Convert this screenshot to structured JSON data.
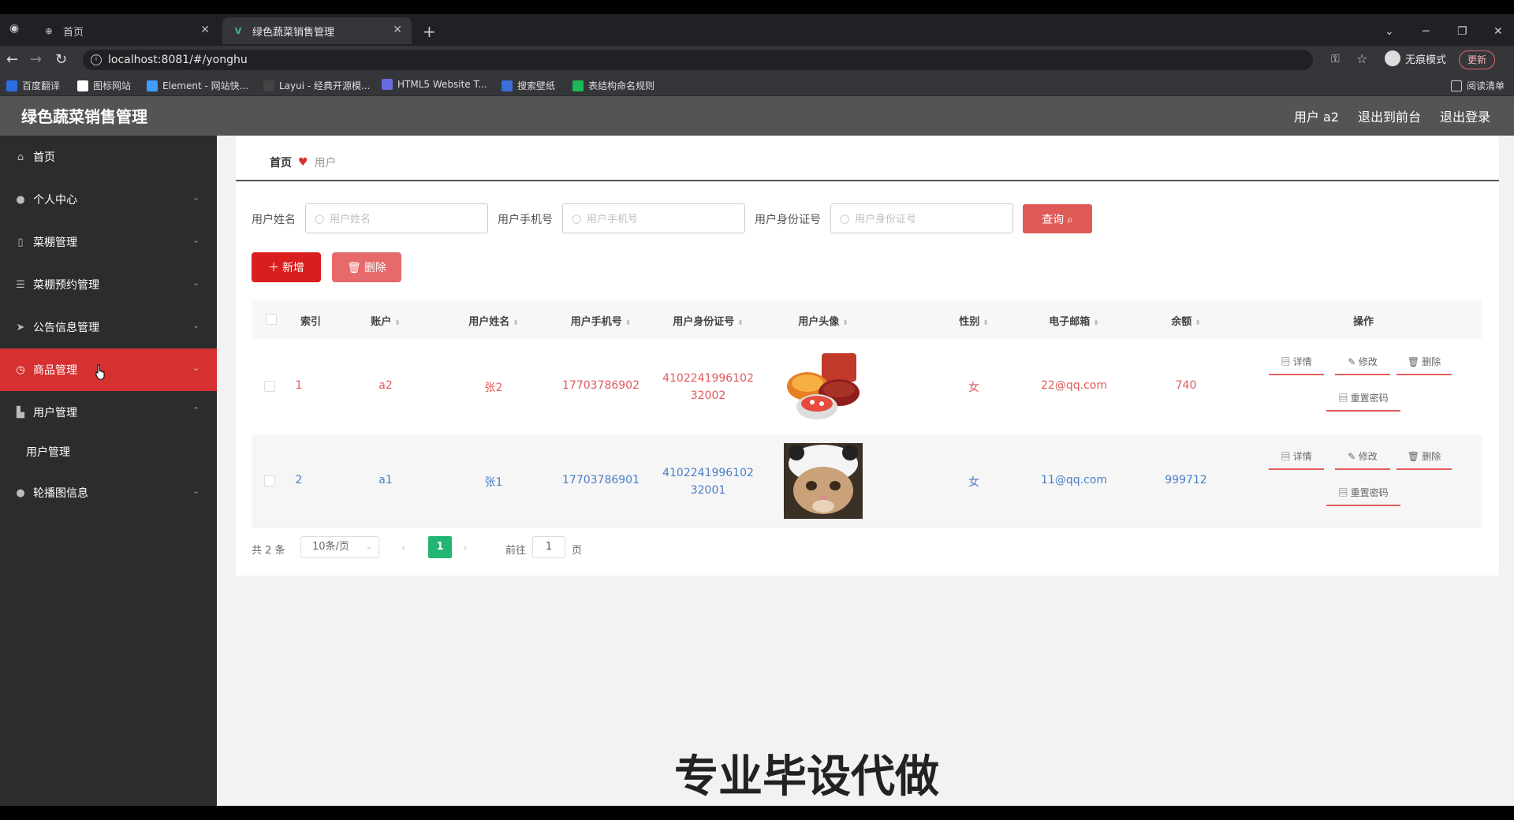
{
  "browser": {
    "tabs": [
      {
        "title": "首页",
        "active": false
      },
      {
        "title": "绿色蔬菜销售管理",
        "active": true
      }
    ],
    "url": "localhost:8081/#/yonghu",
    "profile": "无痕模式",
    "update": "更新",
    "bookmarks": [
      "百度翻译",
      "图标网站",
      "Element - 网站快...",
      "Layui - 经典开源模...",
      "HTML5 Website T...",
      "搜索壁纸",
      "表结构命名规则"
    ],
    "reading_list": "阅读清单"
  },
  "app": {
    "title": "绿色蔬菜销售管理",
    "header_links": [
      "用户 a2",
      "退出到前台",
      "退出登录"
    ]
  },
  "sidebar": {
    "items": [
      {
        "label": "首页",
        "icon": "home-icon",
        "chevron": false
      },
      {
        "label": "个人中心",
        "icon": "user-icon",
        "chevron": true
      },
      {
        "label": "菜棚管理",
        "icon": "lock-icon",
        "chevron": true
      },
      {
        "label": "菜棚预约管理",
        "icon": "sliders-icon",
        "chevron": true
      },
      {
        "label": "公告信息管理",
        "icon": "send-icon",
        "chevron": true
      },
      {
        "label": "商品管理",
        "icon": "clock-icon",
        "chevron": true,
        "active": true
      },
      {
        "label": "用户管理",
        "icon": "briefcase-icon",
        "chevron": true,
        "expanded": true
      },
      {
        "label": "轮播图信息",
        "icon": "user-icon",
        "chevron": true
      }
    ],
    "submenu": "用户管理"
  },
  "breadcrumb": {
    "home": "首页",
    "current": "用户"
  },
  "filters": [
    {
      "label": "用户姓名",
      "placeholder": "用户姓名"
    },
    {
      "label": "用户手机号",
      "placeholder": "用户手机号"
    },
    {
      "label": "用户身份证号",
      "placeholder": "用户身份证号"
    }
  ],
  "buttons": {
    "query": "查询",
    "add": "新增",
    "delete": "删除"
  },
  "table": {
    "headers": [
      "索引",
      "账户",
      "用户姓名",
      "用户手机号",
      "用户身份证号",
      "用户头像",
      "性别",
      "电子邮箱",
      "余额",
      "操作"
    ],
    "rows": [
      {
        "index": "1",
        "account": "a2",
        "name": "张2",
        "phone": "17703786902",
        "id_line1": "4102241996102",
        "id_line2": "32002",
        "gender": "女",
        "email": "22@qq.com",
        "balance": "740"
      },
      {
        "index": "2",
        "account": "a1",
        "name": "张1",
        "phone": "17703786901",
        "id_line1": "4102241996102",
        "id_line2": "32001",
        "gender": "女",
        "email": "11@qq.com",
        "balance": "999712"
      }
    ],
    "actions": [
      "详情",
      "修改",
      "删除",
      "重置密码"
    ]
  },
  "pagination": {
    "total": "共 2 条",
    "page_size": "10条/页",
    "current": "1",
    "goto_label": "前往",
    "goto_value": "1",
    "page_suffix": "页"
  },
  "watermark": "专业毕设代做",
  "colors": {
    "accent": "#d63031",
    "sidebar": "#2c2c2c",
    "header": "#545454",
    "pager_active": "#22b573"
  }
}
